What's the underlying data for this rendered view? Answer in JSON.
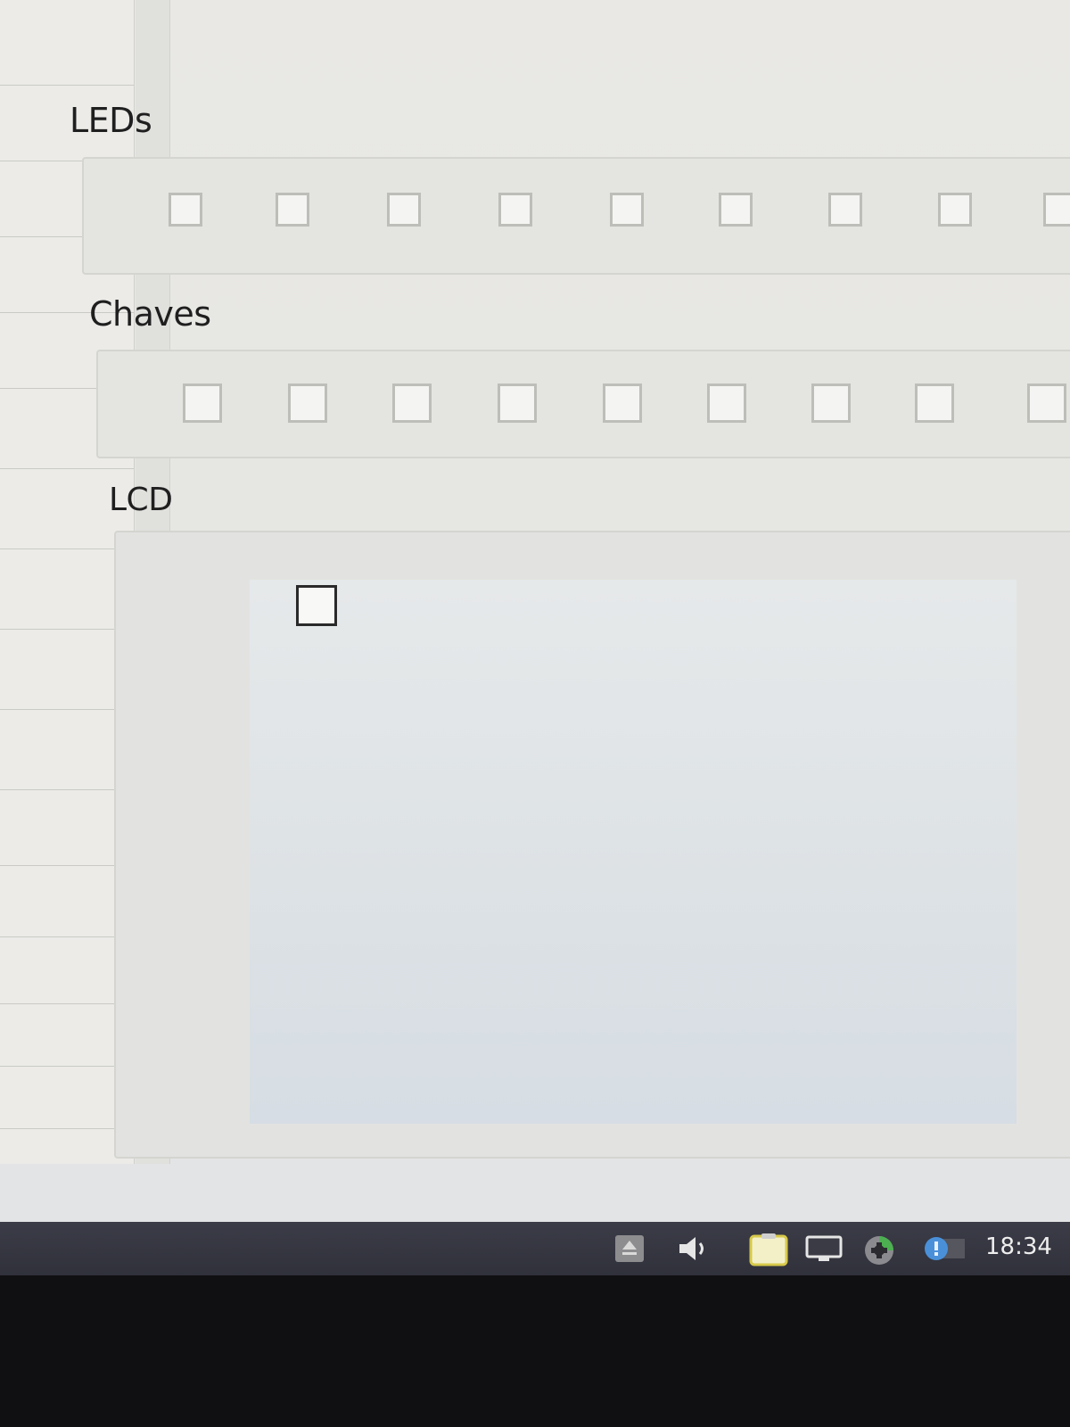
{
  "sections": {
    "leds": {
      "title": "LEDs",
      "count": 9
    },
    "chaves": {
      "title": "Chaves",
      "count": 9
    },
    "lcd": {
      "title": "LCD"
    }
  },
  "taskbar": {
    "clock": "18:34",
    "icons": [
      "eject-icon",
      "speaker-icon",
      "clipboard-icon",
      "monitor-icon",
      "network-icon",
      "update-icon"
    ]
  },
  "colors": {
    "taskbar": "#34353f",
    "window_bg": "#e7e7e4"
  }
}
